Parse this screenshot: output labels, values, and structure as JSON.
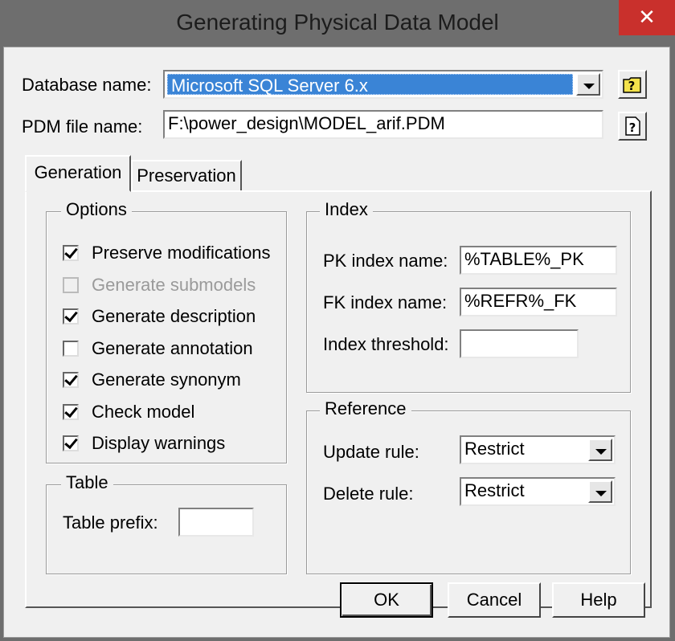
{
  "window": {
    "title": "Generating Physical Data Model",
    "close_glyph": "✕"
  },
  "database": {
    "label": "Database name:",
    "value": "Microsoft SQL Server 6.x"
  },
  "pdm": {
    "label": "PDM file name:",
    "value": "F:\\power_design\\MODEL_arif.PDM"
  },
  "tabs": [
    {
      "label": "Generation",
      "active": true
    },
    {
      "label": "Preservation",
      "active": false
    }
  ],
  "options": {
    "title": "Options",
    "items": [
      {
        "label": "Preserve modifications",
        "checked": true,
        "enabled": true
      },
      {
        "label": "Generate submodels",
        "checked": false,
        "enabled": false
      },
      {
        "label": "Generate description",
        "checked": true,
        "enabled": true
      },
      {
        "label": "Generate annotation",
        "checked": false,
        "enabled": true
      },
      {
        "label": "Generate synonym",
        "checked": true,
        "enabled": true
      },
      {
        "label": "Check model",
        "checked": true,
        "enabled": true
      },
      {
        "label": "Display warnings",
        "checked": true,
        "enabled": true
      }
    ]
  },
  "table": {
    "title": "Table",
    "prefix_label": "Table prefix:",
    "prefix_value": ""
  },
  "index": {
    "title": "Index",
    "pk_label": "PK index name:",
    "pk_value": "%TABLE%_PK",
    "fk_label": "FK index name:",
    "fk_value": "%REFR%_FK",
    "threshold_label": "Index threshold:",
    "threshold_value": ""
  },
  "reference": {
    "title": "Reference",
    "update_label": "Update rule:",
    "update_value": "Restrict",
    "delete_label": "Delete rule:",
    "delete_value": "Restrict"
  },
  "buttons": {
    "ok": "OK",
    "cancel": "Cancel",
    "help": "Help"
  },
  "colors": {
    "selection": "#3a84d6",
    "close": "#c9302c",
    "icon_yellow": "#f3e24b"
  }
}
